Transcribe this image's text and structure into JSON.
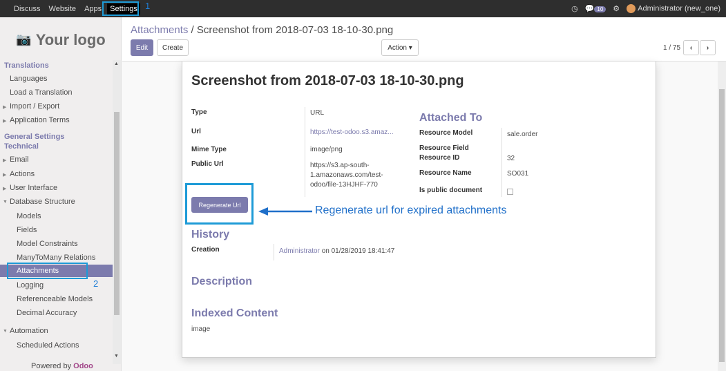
{
  "topbar": {
    "menu": [
      "Discuss",
      "Website",
      "Apps",
      "Settings"
    ],
    "marker_1": "1",
    "badge": "10",
    "user": "Administrator (new_one)"
  },
  "sidebar": {
    "logo_text": "Your logo",
    "sections": {
      "translations": "Translations",
      "general_settings": "General Settings",
      "technical": "Technical"
    },
    "items": {
      "languages": "Languages",
      "load_translation": "Load a Translation",
      "import_export": "Import / Export",
      "application_terms": "Application Terms",
      "email": "Email",
      "actions": "Actions",
      "user_interface": "User Interface",
      "database_structure": "Database Structure",
      "models": "Models",
      "fields": "Fields",
      "model_constraints": "Model Constraints",
      "many2many": "ManyToMany Relations",
      "attachments": "Attachments",
      "logging": "Logging",
      "referenceable": "Referenceable Models",
      "decimal_accuracy": "Decimal Accuracy",
      "automation": "Automation",
      "scheduled_actions": "Scheduled Actions"
    },
    "marker_2": "2",
    "powered_by": "Powered by",
    "powered_brand": "Odoo"
  },
  "control_panel": {
    "breadcrumb_parent": "Attachments",
    "breadcrumb_sep": "/",
    "breadcrumb_current": "Screenshot from 2018-07-03 18-10-30.png",
    "edit_label": "Edit",
    "create_label": "Create",
    "action_label": "Action ▾",
    "pager": "1 / 75"
  },
  "form": {
    "title": "Screenshot from 2018-07-03 18-10-30.png",
    "type_label": "Type",
    "type_value": "URL",
    "url_label": "Url",
    "url_value": "https://test-odoo.s3.amaz...",
    "mime_label": "Mime Type",
    "mime_value": "image/png",
    "public_url_label": "Public Url",
    "public_url_line1": "https://s3.ap-south-",
    "public_url_line2": "1.amazonaws.com/test-",
    "public_url_line3": "odoo/file-13HJHF-770",
    "attached_to": "Attached To",
    "resource_model_label": "Resource Model",
    "resource_model_value": "sale.order",
    "resource_field_label": "Resource Field",
    "resource_id_label": "Resource ID",
    "resource_id_value": "32",
    "resource_name_label": "Resource Name",
    "resource_name_value": "SO031",
    "is_public_label": "Is public document",
    "regenerate_label": "Regenerate Url",
    "annotation": "Regenerate url for expired attachments",
    "history": "History",
    "creation_label": "Creation",
    "creation_user": "Administrator",
    "creation_on": "on 01/28/2019 18:41:47",
    "description": "Description",
    "indexed_content": "Indexed Content",
    "indexed_value": "image"
  },
  "colors": {
    "accent": "#7c7bad",
    "highlight_box": "#1e9bd7",
    "annotation": "#1f6fc9"
  }
}
